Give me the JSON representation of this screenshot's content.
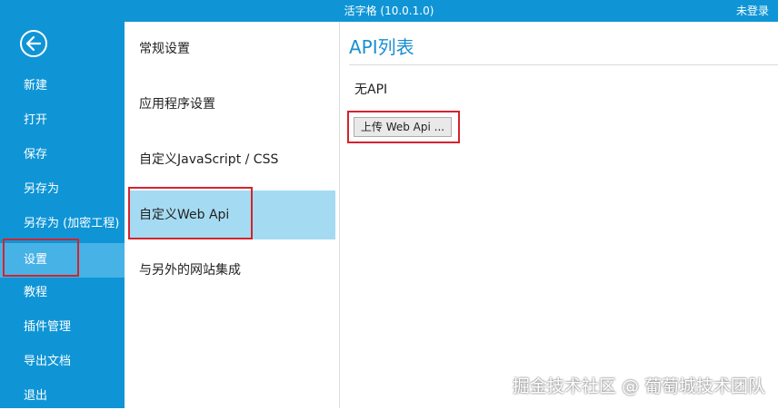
{
  "titlebar": {
    "title": "活字格 (10.0.1.0)",
    "login_status": "未登录"
  },
  "backstage_nav": {
    "back_icon": "back-arrow-icon",
    "items": [
      {
        "label": "新建"
      },
      {
        "label": "打开"
      },
      {
        "label": "保存"
      },
      {
        "label": "另存为"
      },
      {
        "label": "另存为 (加密工程)"
      },
      {
        "label": "设置",
        "active": true
      },
      {
        "label": "教程"
      },
      {
        "label": "插件管理"
      },
      {
        "label": "导出文档"
      },
      {
        "label": "退出"
      }
    ]
  },
  "settings_categories": [
    {
      "label": "常规设置"
    },
    {
      "label": "应用程序设置"
    },
    {
      "label": "自定义JavaScript / CSS"
    },
    {
      "label": "自定义Web Api",
      "active": true
    },
    {
      "label": "与另外的网站集成"
    }
  ],
  "content": {
    "title": "API列表",
    "empty_text": "无API",
    "upload_button_label": "上传 Web Api ..."
  },
  "watermark": "掘金技术社区 @ 葡萄城技术团队",
  "colors": {
    "nav_background": "#0f95d6",
    "nav_active": "#47b2e6",
    "category_active": "#a5dbf2",
    "title_blue": "#1a8fd0",
    "highlight_red": "#d4232c"
  }
}
